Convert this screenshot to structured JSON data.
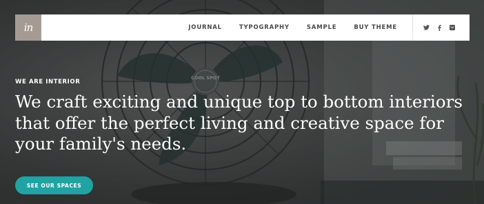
{
  "nav": {
    "logo_text": "in",
    "items": [
      {
        "label": "JOURNAL"
      },
      {
        "label": "TYPOGRAPHY"
      },
      {
        "label": "SAMPLE"
      },
      {
        "label": "BUY THEME"
      }
    ],
    "social": [
      {
        "icon": "twitter-icon",
        "glyph": "t"
      },
      {
        "icon": "facebook-icon",
        "glyph": "f"
      },
      {
        "icon": "email-icon",
        "glyph": "✉"
      }
    ]
  },
  "hero": {
    "eyebrow": "WE ARE INTERIOR",
    "headline": "We craft exciting and unique top to bottom interiors that offer the perfect living and creative space for your family's needs.",
    "cta_label": "SEE OUR SPACES",
    "fan_badge_text": "COOL SPOT"
  },
  "colors": {
    "accent": "#21a3a3",
    "logo_bg": "#a69b92",
    "nav_bg": "#ffffff",
    "text_light": "#ffffff"
  }
}
